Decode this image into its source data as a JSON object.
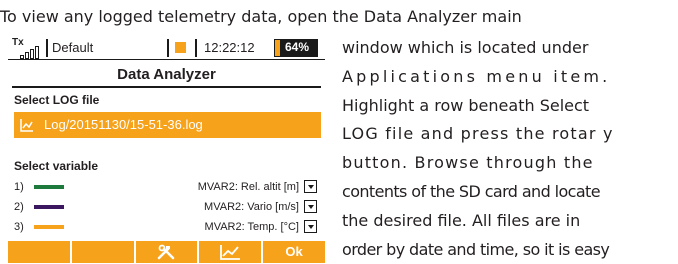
{
  "intro": "To view any logged telemetry data, open the Data Analyzer main",
  "body_lines": [
    "window which is located under",
    "Applications menu item.",
    "Highlight a row beneath Select",
    "LOG file and press the rotar y",
    "button. Browse through the",
    "contents of the SD card and locate",
    "the desired file. All files are in",
    "order by date and time, so it is easy"
  ],
  "screen": {
    "status": {
      "signal_label": "Tx",
      "profile": "Default",
      "time": "12:22:12",
      "battery": "64%",
      "battery_level": 0.64
    },
    "title": "Data Analyzer",
    "log_section": "Select LOG file",
    "log_file": "Log/20151130/15-51-36.log",
    "variable_section": "Select variable",
    "variables": [
      {
        "num": "1)",
        "name": "MVAR2: Rel. altit  [m]",
        "color": "#1e7a3c"
      },
      {
        "num": "2)",
        "name": "MVAR2: Vario  [m/s]",
        "color": "#3b1760"
      },
      {
        "num": "3)",
        "name": "MVAR2: Temp.  [°C]",
        "color": "#f7a21b"
      }
    ],
    "softkeys": [
      "",
      "",
      "tools-icon",
      "chart-icon",
      "Ok"
    ],
    "accent": "#f7a21b"
  }
}
